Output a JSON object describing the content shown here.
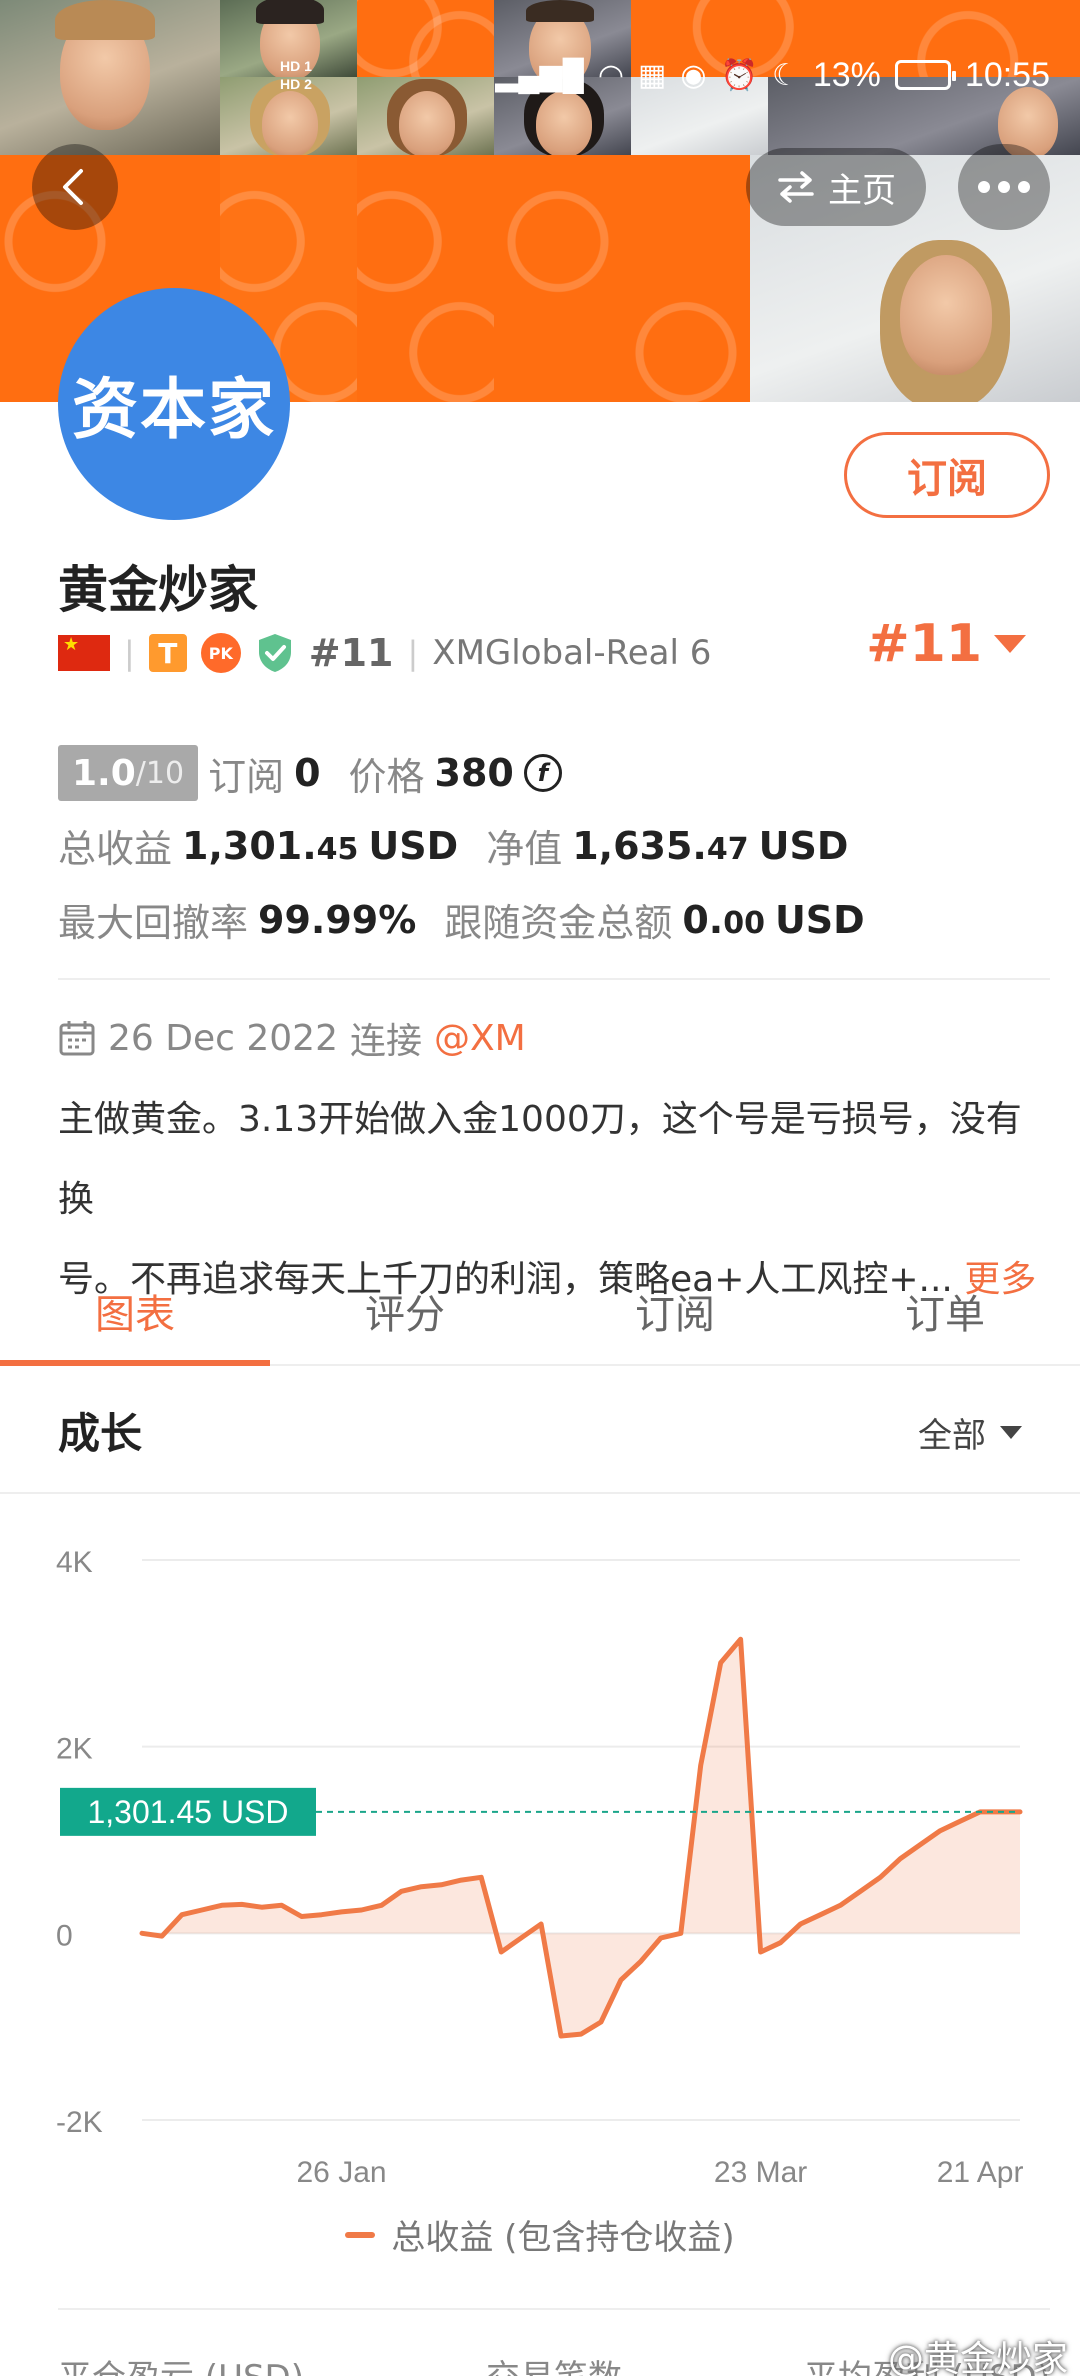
{
  "status_bar": {
    "time": "10:55",
    "battery": "13%",
    "network_tag_1": "HD 1",
    "network_tag_2": "HD 2",
    "signal_label": "4G"
  },
  "nav": {
    "home_label": "主页"
  },
  "profile": {
    "avatar_text": "资本家",
    "name": "黄金炒家",
    "subscribe_label": "订阅",
    "rank_badge": "#11",
    "rank_big": "#11",
    "broker": "XMGlobal-Real 6",
    "badge_t": "T",
    "badge_pk": "PK"
  },
  "stats": {
    "score": "1.0",
    "score_max": "/10",
    "subscribers_label": "订阅",
    "subscribers_value": "0",
    "price_label": "价格",
    "price_value": "380",
    "coin_symbol": "f",
    "total_profit_label": "总收益",
    "total_profit_int": "1,301.",
    "total_profit_dec": "45",
    "total_profit_unit": "USD",
    "equity_label": "净值",
    "equity_int": "1,635.",
    "equity_dec": "47",
    "equity_unit": "USD",
    "max_drawdown_label": "最大回撤率",
    "max_drawdown_value": "99.99%",
    "follow_total_label": "跟随资金总额",
    "follow_total_int": "0.",
    "follow_total_dec": "00",
    "follow_total_unit": "USD"
  },
  "connection": {
    "date": "26 Dec 2022",
    "connect_label": "连接",
    "broker_handle": "@XM"
  },
  "description": {
    "line1": "主做黄金。3.13开始做入金1000刀，这个号是亏损号，没有换",
    "line2": "号。不再追求每天上千刀的利润，策略ea+人工风控+...",
    "more_label": "更多"
  },
  "tabs": [
    {
      "label": "图表",
      "active": true
    },
    {
      "label": "评分",
      "active": false
    },
    {
      "label": "订阅",
      "active": false
    },
    {
      "label": "订单",
      "active": false
    }
  ],
  "section": {
    "title": "成长",
    "filter_label": "全部"
  },
  "chart_data": {
    "type": "area",
    "title": "",
    "ylabel": "",
    "xlabel": "",
    "ylim": [
      -2000,
      4000
    ],
    "yticks": [
      "4K",
      "2K",
      "0",
      "-2K"
    ],
    "ytick_values": [
      4000,
      2000,
      0,
      -2000
    ],
    "xtick_labels": [
      "26 Jan",
      "23 Mar",
      "21 Apr"
    ],
    "current_value_label": "1,301.45 USD",
    "current_value": 1301.45,
    "series": [
      {
        "name": "总收益 (包含持仓收益)",
        "color": "#f07a47",
        "x": [
          "26 Dec",
          "28 Dec",
          "30 Dec",
          "3 Jan",
          "6 Jan",
          "10 Jan",
          "14 Jan",
          "18 Jan",
          "20 Jan",
          "22 Jan",
          "26 Jan",
          "30 Jan",
          "3 Feb",
          "6 Feb",
          "10 Feb",
          "14 Feb",
          "18 Feb",
          "19 Feb",
          "22 Feb",
          "26 Feb",
          "2 Mar",
          "4 Mar",
          "6 Mar",
          "8 Mar",
          "10 Mar",
          "12 Mar",
          "14 Mar",
          "16 Mar",
          "18 Mar",
          "20 Mar",
          "22 Mar",
          "24 Mar",
          "26 Mar",
          "28 Mar",
          "30 Mar",
          "1 Apr",
          "4 Apr",
          "7 Apr",
          "10 Apr",
          "13 Apr",
          "16 Apr",
          "19 Apr",
          "21 Apr",
          "24 Apr",
          "26 Apr"
        ],
        "values": [
          0,
          -30,
          200,
          250,
          300,
          310,
          280,
          300,
          180,
          200,
          230,
          250,
          300,
          450,
          500,
          520,
          570,
          600,
          -200,
          -50,
          100,
          -1100,
          -1080,
          -950,
          -500,
          -300,
          -50,
          0,
          1800,
          2900,
          3150,
          -200,
          -100,
          100,
          200,
          300,
          450,
          600,
          800,
          950,
          1100,
          1200,
          1301.45,
          1301.45,
          1301.45
        ]
      }
    ],
    "legend_position": "bottom",
    "grid": true
  },
  "bottom_labels": {
    "col1": "平仓盈亏 (USD)",
    "col2": "交易笔数",
    "col3": "平均盈利 (USD)"
  },
  "watermark": "@黄金炒家"
}
